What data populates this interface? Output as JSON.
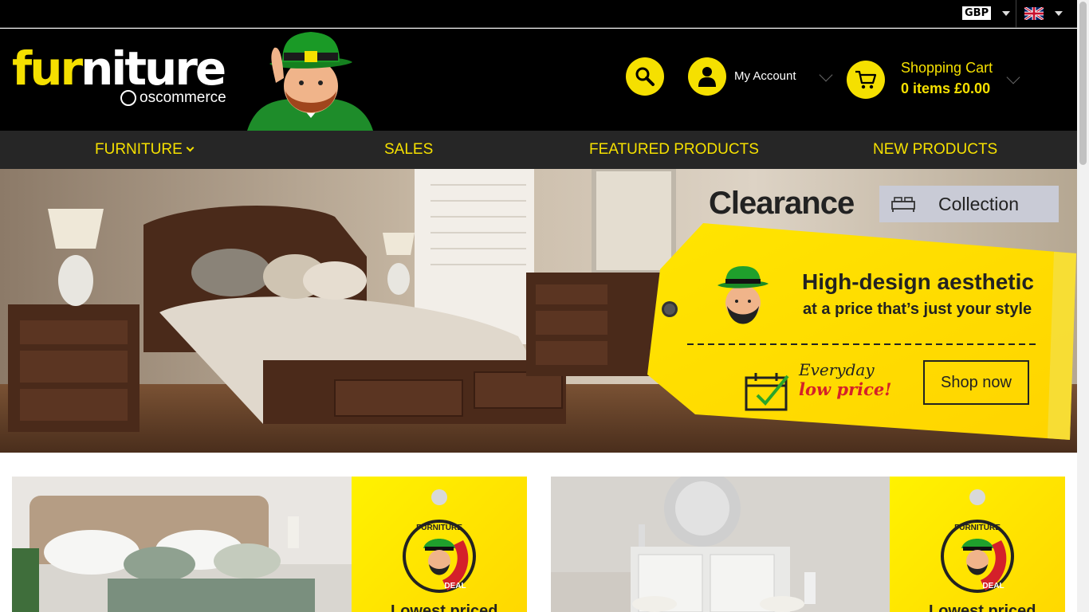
{
  "topbar": {
    "currency_code": "GBP",
    "language_flag": "uk-flag-icon"
  },
  "header": {
    "logo_word_yellow": "fur",
    "logo_word_white": "niture",
    "logo_sub": "oscommerce",
    "account_label": "My Account",
    "cart_title": "Shopping Cart",
    "cart_summary": "0 items £0.00"
  },
  "nav": {
    "items": [
      {
        "label": "FURNITURE"
      },
      {
        "label": "SALES"
      },
      {
        "label": "FEATURED PRODUCTS"
      },
      {
        "label": "NEW PRODUCTS"
      }
    ]
  },
  "hero": {
    "clearance": "Clearance",
    "collection": "Collection",
    "headline": "High-design aesthetic",
    "subline": "at a price that’s just your style",
    "everyday": "Everyday",
    "low_price": "low price!",
    "cta": "Shop now"
  },
  "promos": [
    {
      "badge_top": "FURNITURE",
      "badge_bottom": "DEAL",
      "caption": "Lowest priced"
    },
    {
      "badge_top": "FURNITURE",
      "badge_bottom": "DEAL",
      "caption": "Lowest priced"
    }
  ],
  "colors": {
    "brand_yellow": "#f5e000",
    "header_bg": "#000000",
    "nav_bg": "#262626"
  }
}
